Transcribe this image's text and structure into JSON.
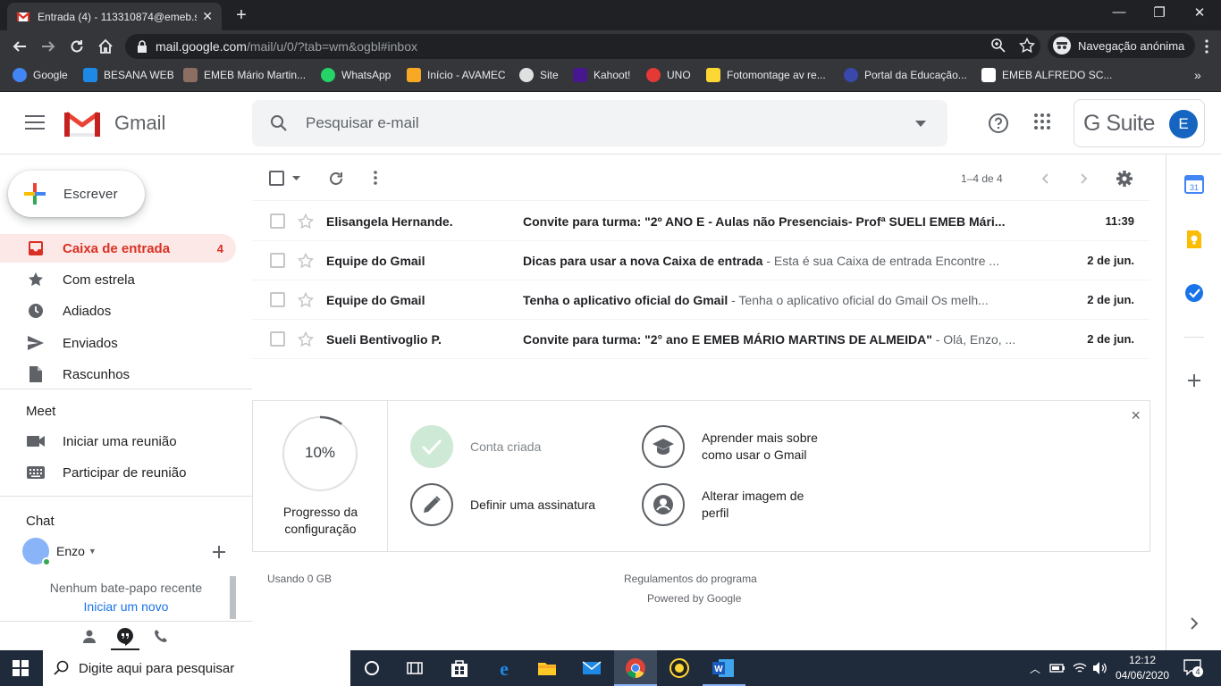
{
  "browser": {
    "tab_title": "Entrada (4) - 113310874@emeb.s",
    "url_host": "mail.google.com",
    "url_path": "/mail/u/0/?tab=wm&ogbl#inbox",
    "profile_label": "Navegação anónima"
  },
  "bookmarks": [
    {
      "label": "Google",
      "color": "#4285f4"
    },
    {
      "label": "BESANA WEB",
      "color": "#1e88e5"
    },
    {
      "label": "EMEB Mário Martin...",
      "color": "#8d6e63"
    },
    {
      "label": "WhatsApp",
      "color": "#25d366"
    },
    {
      "label": "Início - AVAMEC",
      "color": "#f9a825"
    },
    {
      "label": "Site",
      "color": "#e0e0e0"
    },
    {
      "label": "Kahoot!",
      "color": "#46178f"
    },
    {
      "label": "UNO",
      "color": "#e53935"
    },
    {
      "label": "Fotomontage av re...",
      "color": "#fdd835"
    },
    {
      "label": "Portal da Educação...",
      "color": "#3949ab"
    },
    {
      "label": "EMEB ALFREDO SC...",
      "color": "#ffffff"
    }
  ],
  "gmail": {
    "logo_text": "Gmail",
    "search_placeholder": "Pesquisar e-mail",
    "gsuite_text": "G Suite",
    "avatar_letter": "E"
  },
  "sidebar": {
    "compose_label": "Escrever",
    "items": [
      {
        "label": "Caixa de entrada",
        "count": "4"
      },
      {
        "label": "Com estrela"
      },
      {
        "label": "Adiados"
      },
      {
        "label": "Enviados"
      },
      {
        "label": "Rascunhos"
      }
    ],
    "meet_title": "Meet",
    "meet_items": [
      {
        "label": "Iniciar uma reunião"
      },
      {
        "label": "Participar de reunião"
      }
    ],
    "chat_title": "Chat",
    "chat_user": "Enzo",
    "no_chat": "Nenhum bate-papo recente",
    "start_new": "Iniciar um novo"
  },
  "toolbar": {
    "pagination": "1–4 de 4"
  },
  "emails": [
    {
      "sender": "Elisangela Hernande.",
      "subject": "Convite para turma: \"2º ANO E - Aulas não Presenciais- Profª SUELI EMEB Mári...",
      "snippet": "",
      "date": "11:39"
    },
    {
      "sender": "Equipe do Gmail",
      "subject": "Dicas para usar a nova Caixa de entrada",
      "snippet": " - Esta é sua Caixa de entrada Encontre ...",
      "date": "2 de jun."
    },
    {
      "sender": "Equipe do Gmail",
      "subject": "Tenha o aplicativo oficial do Gmail",
      "snippet": " - Tenha o aplicativo oficial do Gmail Os melh...",
      "date": "2 de jun."
    },
    {
      "sender": "Sueli Bentivoglio P.",
      "subject": "Convite para turma: \"2° ano E EMEB MÁRIO MARTINS DE ALMEIDA\"",
      "snippet": " - Olá, Enzo, ...",
      "date": "2 de jun."
    }
  ],
  "setup": {
    "progress_percent": 10,
    "progress_text": "10%",
    "progress_label_1": "Progresso da",
    "progress_label_2": "configuração",
    "tasks": [
      {
        "line1": "Conta criada",
        "line2": ""
      },
      {
        "line1": "Aprender mais sobre",
        "line2": "como usar o Gmail"
      },
      {
        "line1": "Definir uma assinatura",
        "line2": ""
      },
      {
        "line1": "Alterar imagem de",
        "line2": "perfil"
      }
    ],
    "close_label": "×"
  },
  "footer": {
    "storage": "Usando 0 GB",
    "policies": "Regulamentos do programa",
    "powered": "Powered by Google"
  },
  "taskbar": {
    "search_placeholder": "Digite aqui para pesquisar",
    "time": "12:12",
    "date": "04/06/2020",
    "notif_count": "4"
  },
  "colors": {
    "gmail_red": "#d93025",
    "blue_accent": "#1a73e8",
    "active_bg": "#fce8e6"
  }
}
